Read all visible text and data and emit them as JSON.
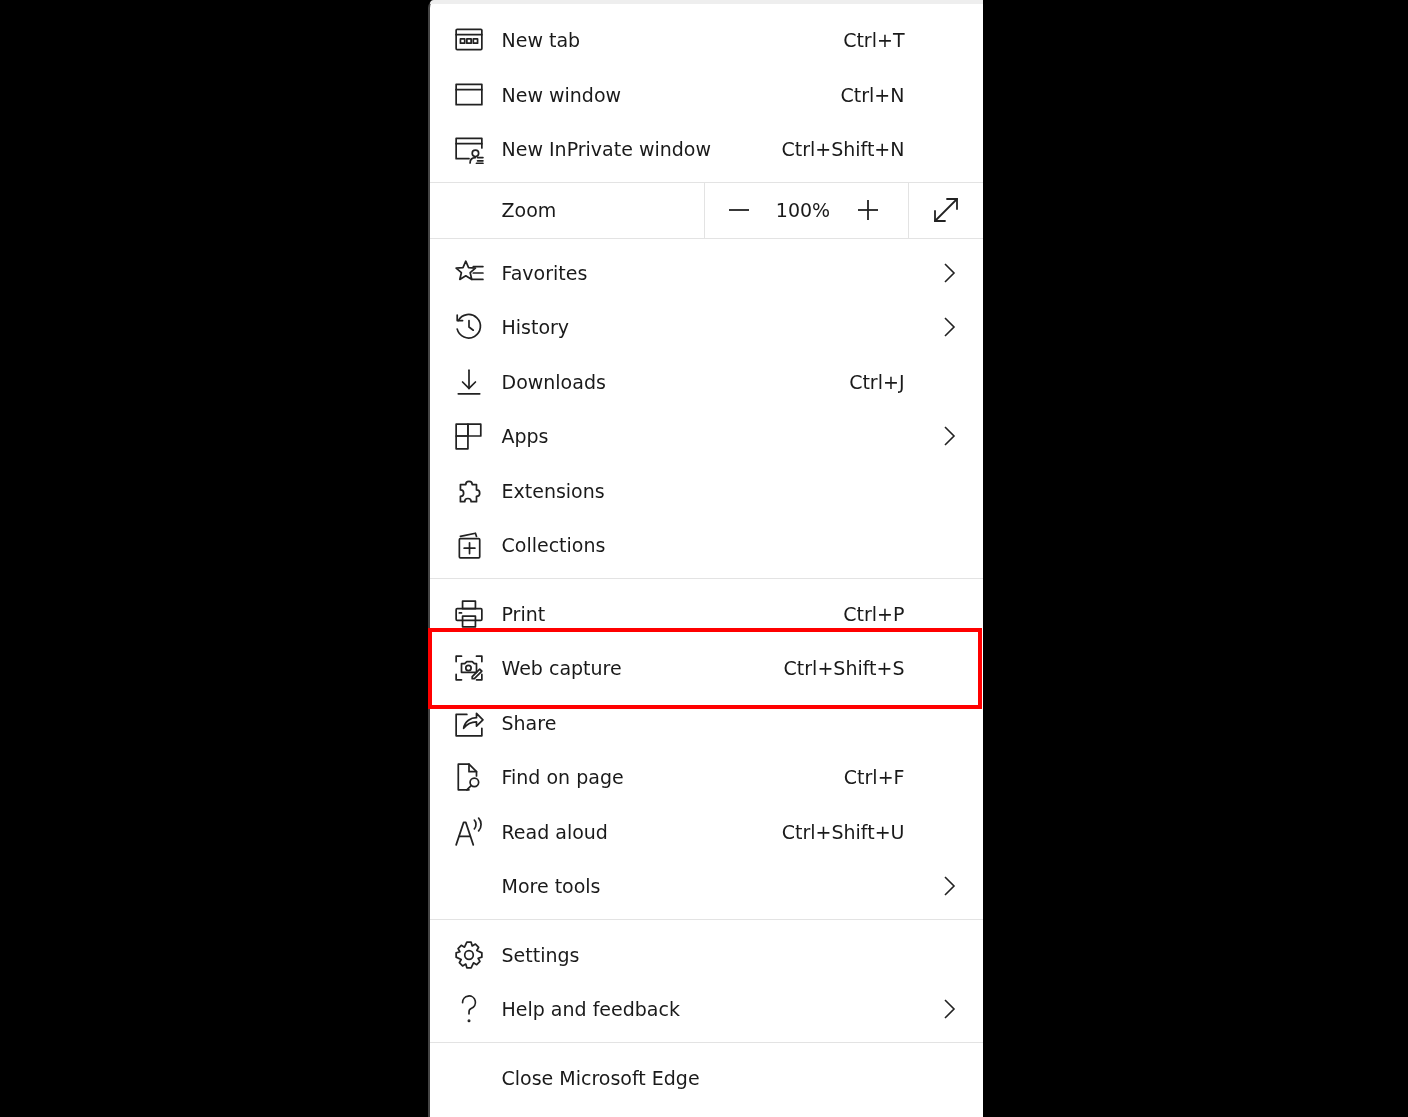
{
  "menu": {
    "groups": [
      {
        "items": [
          {
            "kind": "item",
            "label": "New tab",
            "shortcut": "Ctrl+T",
            "submenu": false,
            "highlighted": false
          },
          {
            "kind": "item",
            "label": "New window",
            "shortcut": "Ctrl+N",
            "submenu": false,
            "highlighted": false
          },
          {
            "kind": "item",
            "label": "New InPrivate window",
            "shortcut": "Ctrl+Shift+N",
            "submenu": false,
            "highlighted": false
          }
        ]
      },
      {
        "items": [
          {
            "kind": "zoom",
            "label": "Zoom",
            "value": "100%"
          }
        ]
      },
      {
        "items": [
          {
            "kind": "item",
            "label": "Favorites",
            "submenu": true,
            "highlighted": false
          },
          {
            "kind": "item",
            "label": "History",
            "submenu": true,
            "highlighted": false
          },
          {
            "kind": "item",
            "label": "Downloads",
            "shortcut": "Ctrl+J",
            "submenu": false,
            "highlighted": false
          },
          {
            "kind": "item",
            "label": "Apps",
            "submenu": true,
            "highlighted": false
          },
          {
            "kind": "item",
            "label": "Extensions",
            "submenu": false,
            "highlighted": false
          },
          {
            "kind": "item",
            "label": "Collections",
            "submenu": false,
            "highlighted": false
          }
        ]
      },
      {
        "items": [
          {
            "kind": "item",
            "label": "Print",
            "shortcut": "Ctrl+P",
            "submenu": false,
            "highlighted": false
          },
          {
            "kind": "item",
            "label": "Web capture",
            "shortcut": "Ctrl+Shift+S",
            "submenu": false,
            "highlighted": true
          },
          {
            "kind": "item",
            "label": "Share",
            "submenu": false,
            "highlighted": false
          },
          {
            "kind": "item",
            "label": "Find on page",
            "shortcut": "Ctrl+F",
            "submenu": false,
            "highlighted": false
          },
          {
            "kind": "item",
            "label": "Read aloud",
            "shortcut": "Ctrl+Shift+U",
            "submenu": false,
            "highlighted": false
          },
          {
            "kind": "item",
            "label": "More tools",
            "submenu": true,
            "highlighted": false
          }
        ]
      },
      {
        "items": [
          {
            "kind": "item",
            "label": "Settings",
            "submenu": false,
            "highlighted": false
          },
          {
            "kind": "item",
            "label": "Help and feedback",
            "submenu": true,
            "highlighted": false
          }
        ]
      },
      {
        "items": [
          {
            "kind": "item",
            "label": "Close Microsoft Edge",
            "submenu": false,
            "highlighted": false
          }
        ]
      }
    ]
  }
}
